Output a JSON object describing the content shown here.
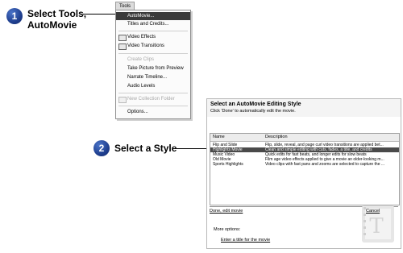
{
  "steps": [
    {
      "number": "1",
      "text": "Select Tools,\nAutoMovie"
    },
    {
      "number": "2",
      "text": "Select a Style"
    }
  ],
  "menu": {
    "title": "Tools",
    "items": [
      {
        "label": "AutoMovie...",
        "selected": true
      },
      {
        "label": "Titles and Credits..."
      },
      {
        "label": "Video Effects",
        "icon": "video-effects-icon"
      },
      {
        "label": "Video Transitions",
        "icon": "video-transitions-icon"
      },
      {
        "label": "Create Clips",
        "disabled": true
      },
      {
        "label": "Take Picture from Preview"
      },
      {
        "label": "Narrate Timeline..."
      },
      {
        "label": "Audio Levels"
      },
      {
        "label": "New Collection Folder",
        "disabled": true,
        "icon": "new-folder-icon"
      },
      {
        "label": "Options..."
      }
    ]
  },
  "automovie": {
    "title": "Select an AutoMovie Editing Style",
    "subtitle": "Click 'Done' to automatically edit the movie.",
    "columns": [
      "Name",
      "Description"
    ],
    "rows": [
      {
        "name": "Flip and Slide",
        "description": "Flip, slide, reveal, and page curl video transitions are applied bet..."
      },
      {
        "name": "Highlights Movie",
        "description": "Clean and simple editing with cuts, fades, a title, and credits",
        "selected": true
      },
      {
        "name": "Music Video",
        "description": "Quick edits for fast beats, and longer edits for slow beats"
      },
      {
        "name": "Old Movie",
        "description": "Film age video effects applied to give a movie an older-looking m..."
      },
      {
        "name": "Sports Highlights",
        "description": "Video clips with fast pans and zooms are selected to capture the ..."
      }
    ],
    "done_label": "Done, edit movie",
    "cancel_label": "Cancel",
    "more_options_label": "More options:",
    "title_link": "Enter a title for the movie"
  },
  "colors": {
    "step_badge": "#1f3f8f",
    "menu_selected": "#3a3a3a",
    "row_selected": "#4a4a4a"
  }
}
